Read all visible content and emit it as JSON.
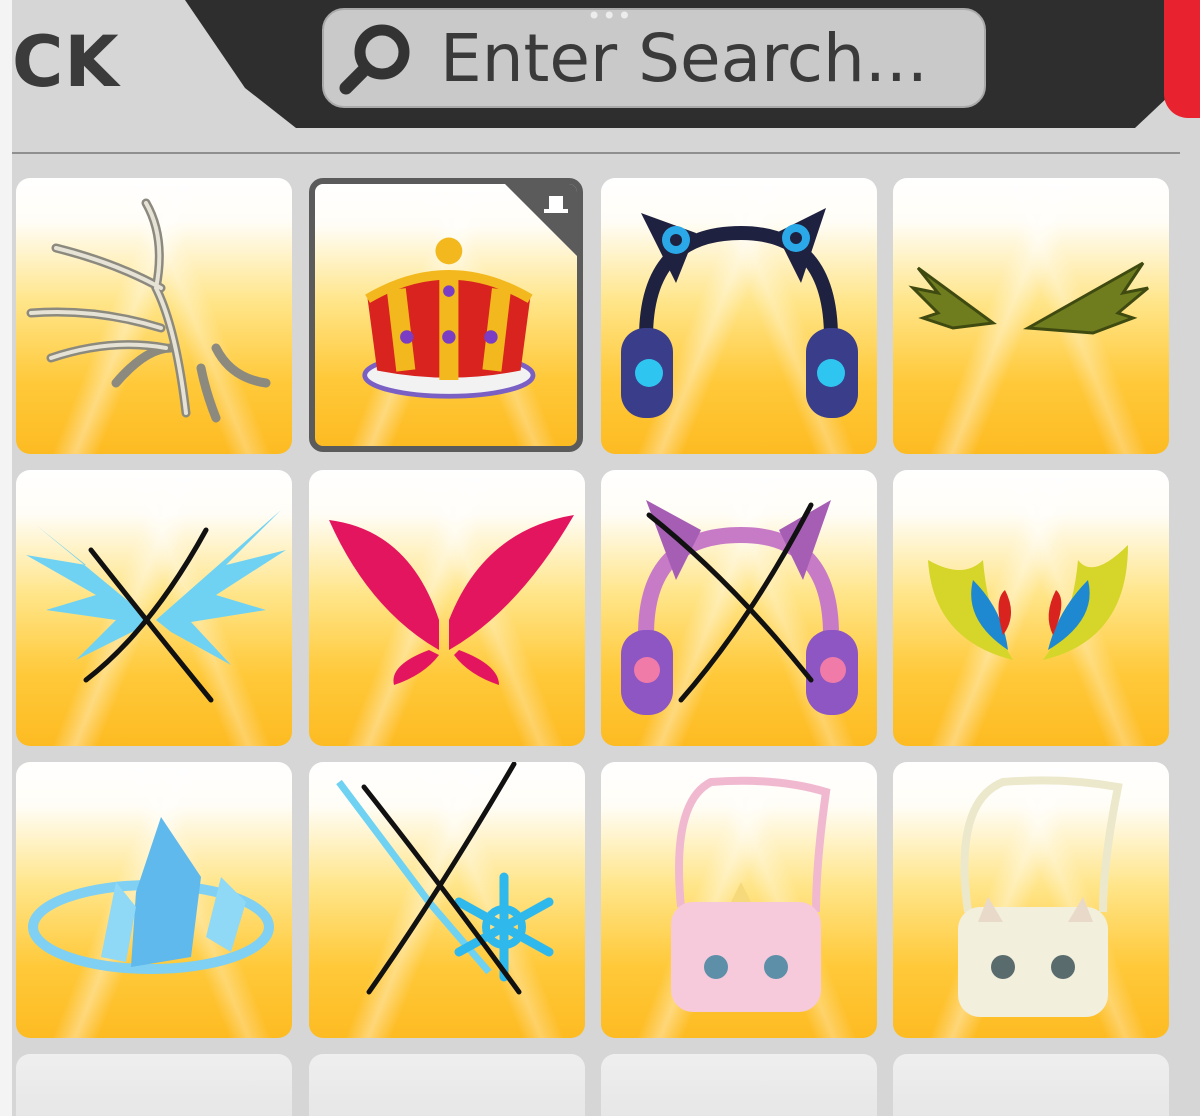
{
  "header": {
    "title_fragment": "CK"
  },
  "search": {
    "placeholder": "Enter Search...",
    "value": ""
  },
  "icons": {
    "search": "magnifier-icon",
    "close": "close-button",
    "handle": "drag-handle-dots",
    "hat_badge": "top-hat-icon"
  },
  "colors": {
    "close_button": "#e8222e",
    "card_top": "#ffffff",
    "card_bottom": "#fdbb22",
    "selected_border": "#5b5b5b",
    "cross_mark": "#111111"
  },
  "grid": {
    "items": [
      {
        "name": "skeleton-wings",
        "selected": false,
        "crossed_out": false
      },
      {
        "name": "royal-crown",
        "selected": true,
        "crossed_out": false,
        "badge": "top-hat-icon"
      },
      {
        "name": "dark-cat-ear-headphones",
        "selected": false,
        "crossed_out": false
      },
      {
        "name": "green-dragon-wings",
        "selected": false,
        "crossed_out": false
      },
      {
        "name": "ice-wings",
        "selected": false,
        "crossed_out": true
      },
      {
        "name": "pink-butterfly-wings",
        "selected": false,
        "crossed_out": false
      },
      {
        "name": "pink-cat-ear-headphones",
        "selected": false,
        "crossed_out": true
      },
      {
        "name": "rainbow-wings",
        "selected": false,
        "crossed_out": false
      },
      {
        "name": "ice-tiara",
        "selected": false,
        "crossed_out": false
      },
      {
        "name": "snowflake-wand",
        "selected": false,
        "crossed_out": true
      },
      {
        "name": "unicorn-purse",
        "selected": false,
        "crossed_out": false
      },
      {
        "name": "llama-purse",
        "selected": false,
        "crossed_out": false
      }
    ]
  }
}
